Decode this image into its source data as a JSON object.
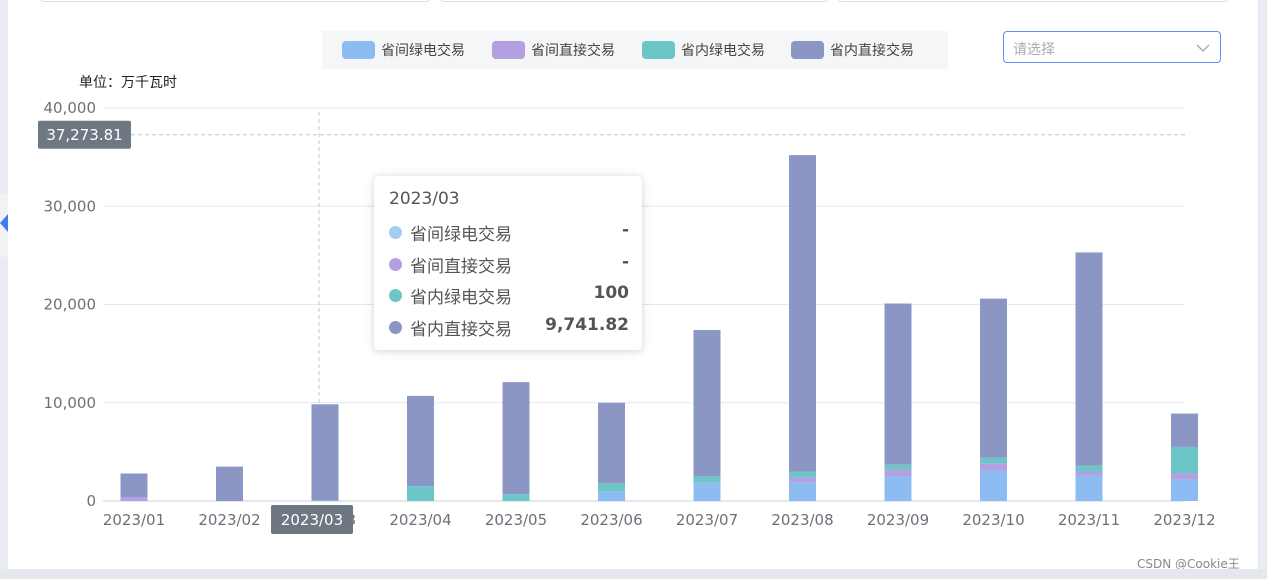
{
  "legend": {
    "items": [
      {
        "label": "省间绿电交易",
        "color": "#8cbcf2"
      },
      {
        "label": "省间直接交易",
        "color": "#b39fe2"
      },
      {
        "label": "省内绿电交易",
        "color": "#6cc6c8"
      },
      {
        "label": "省内直接交易",
        "color": "#8c96c4"
      }
    ]
  },
  "select": {
    "placeholder": "请选择"
  },
  "unit_label": "单位：万千瓦时",
  "chart_data": {
    "type": "bar",
    "stacked": true,
    "categories": [
      "2023/01",
      "2023/02",
      "2023/03",
      "2023/04",
      "2023/05",
      "2023/06",
      "2023/07",
      "2023/08",
      "2023/09",
      "2023/10",
      "2023/11",
      "2023/12"
    ],
    "series": [
      {
        "name": "省间绿电交易",
        "color": "#8cbcf2",
        "values": [
          0,
          0,
          0,
          0,
          0,
          1000,
          1900,
          1900,
          2500,
          3100,
          2600,
          2200
        ]
      },
      {
        "name": "省间直接交易",
        "color": "#b39fe2",
        "values": [
          400,
          0,
          0,
          0,
          0,
          0,
          0,
          500,
          700,
          700,
          400,
          600
        ]
      },
      {
        "name": "省内绿电交易",
        "color": "#6cc6c8",
        "values": [
          0,
          0,
          100,
          1500,
          700,
          800,
          600,
          600,
          500,
          600,
          600,
          2700
        ]
      },
      {
        "name": "省内直接交易",
        "color": "#8c96c4",
        "values": [
          2400,
          3500,
          9741.82,
          9200,
          11400,
          8200,
          14900,
          32200,
          16400,
          16200,
          21700,
          3400
        ]
      }
    ],
    "ylim": [
      0,
      40000
    ],
    "yticks": [
      "0",
      "10,000",
      "20,000",
      "30,000",
      "40,000"
    ],
    "ytick_values": [
      0,
      10000,
      20000,
      30000,
      40000
    ],
    "grid": true,
    "legend_position": "top",
    "crosshair": {
      "category": "2023/03",
      "y_value": 37273.81,
      "y_label": "37,273.81",
      "x_label": "2023/03"
    }
  },
  "tooltip": {
    "title": "2023/03",
    "rows": [
      {
        "name": "省间绿电交易",
        "value": "-",
        "color": "#a5cdf4"
      },
      {
        "name": "省间直接交易",
        "value": "-",
        "color": "#b39fe2"
      },
      {
        "name": "省内绿电交易",
        "value": "100",
        "color": "#6cc6c8"
      },
      {
        "name": "省内直接交易",
        "value": "9,741.82",
        "color": "#8c96c4"
      }
    ]
  },
  "watermark": "CSDN @Cookie王"
}
